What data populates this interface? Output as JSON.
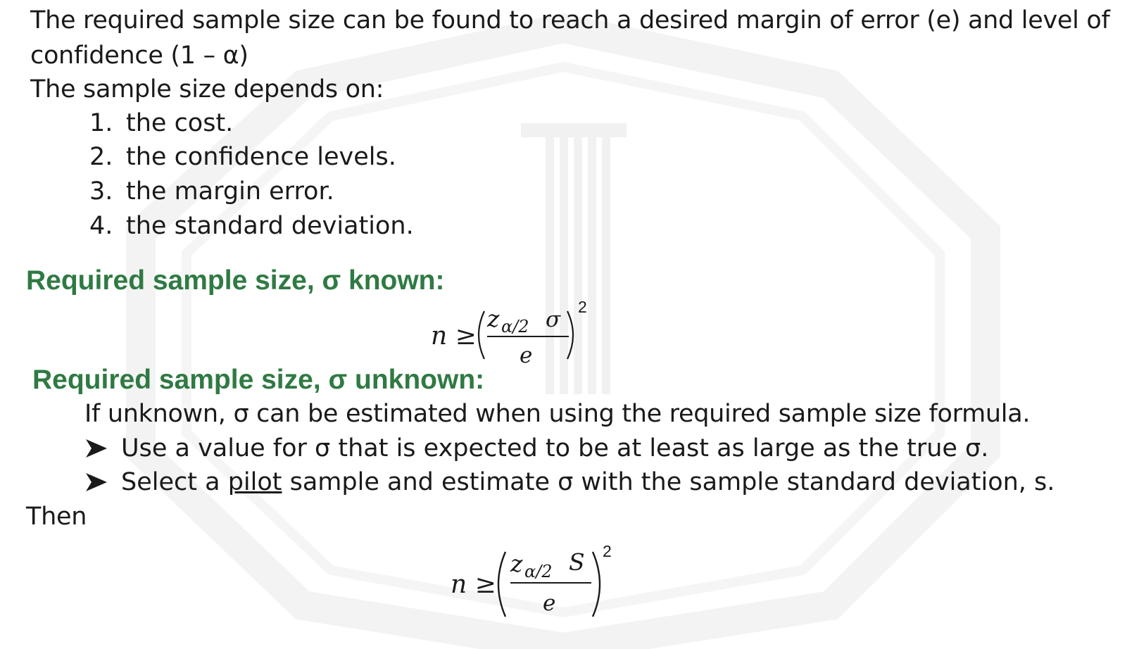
{
  "intro": {
    "line1": "The required sample size can be found to reach a desired margin of error (e) and level of",
    "line2": "confidence (1 – α)",
    "line3": "The sample size depends on:"
  },
  "depends_list": [
    {
      "num": "1.",
      "text": "the cost."
    },
    {
      "num": "2.",
      "text": "the confidence levels."
    },
    {
      "num": "3.",
      "text": "the margin error."
    },
    {
      "num": "4.",
      "text": "the standard deviation."
    }
  ],
  "known_heading": "Required sample size, σ  known:",
  "unknown_heading": "Required sample size, σ unknown:",
  "formula_known": {
    "lhs": "n ≥",
    "z": "z",
    "sub": "α/2",
    "numerator_var": "σ",
    "denominator": "e",
    "exponent": "2"
  },
  "unknown_text": "If unknown, σ can be estimated when using the required sample size formula.",
  "bullets": {
    "b1": "Use a value for σ that is expected to be at least as large as the true σ.",
    "b2_before": "Select a ",
    "b2_underlined": "pilot",
    "b2_after": " sample and estimate σ with the sample standard deviation, s."
  },
  "then_label": "Then",
  "formula_unknown": {
    "lhs": "n ≥",
    "z": "z",
    "sub": "α/2",
    "numerator_var": "S",
    "denominator": "e",
    "exponent": "2"
  }
}
